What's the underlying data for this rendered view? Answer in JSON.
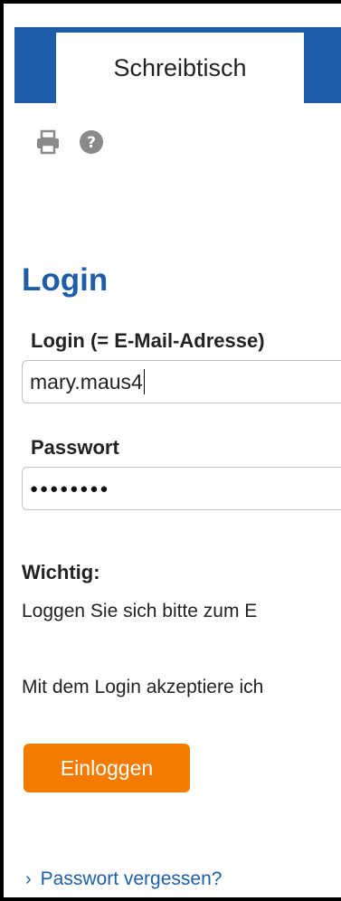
{
  "header": {
    "tab_label": "Schreibtisch"
  },
  "toolbar": {
    "print_icon": "print-icon",
    "help_icon": "help-icon"
  },
  "login": {
    "title": "Login",
    "email_label": "Login (= E-Mail-Adresse)",
    "email_value": "mary.maus4",
    "password_label": "Passwort",
    "password_dots": "●●●●●●●●",
    "important_heading": "Wichtig:",
    "important_text": "Loggen Sie sich bitte zum E",
    "accept_text": "Mit dem Login akzeptiere ich",
    "submit_label": "Einloggen",
    "forgot_chevron": "›",
    "forgot_label": "Passwort vergessen?"
  },
  "colors": {
    "brand_blue": "#1e5ea8",
    "button_orange": "#f47b00"
  }
}
